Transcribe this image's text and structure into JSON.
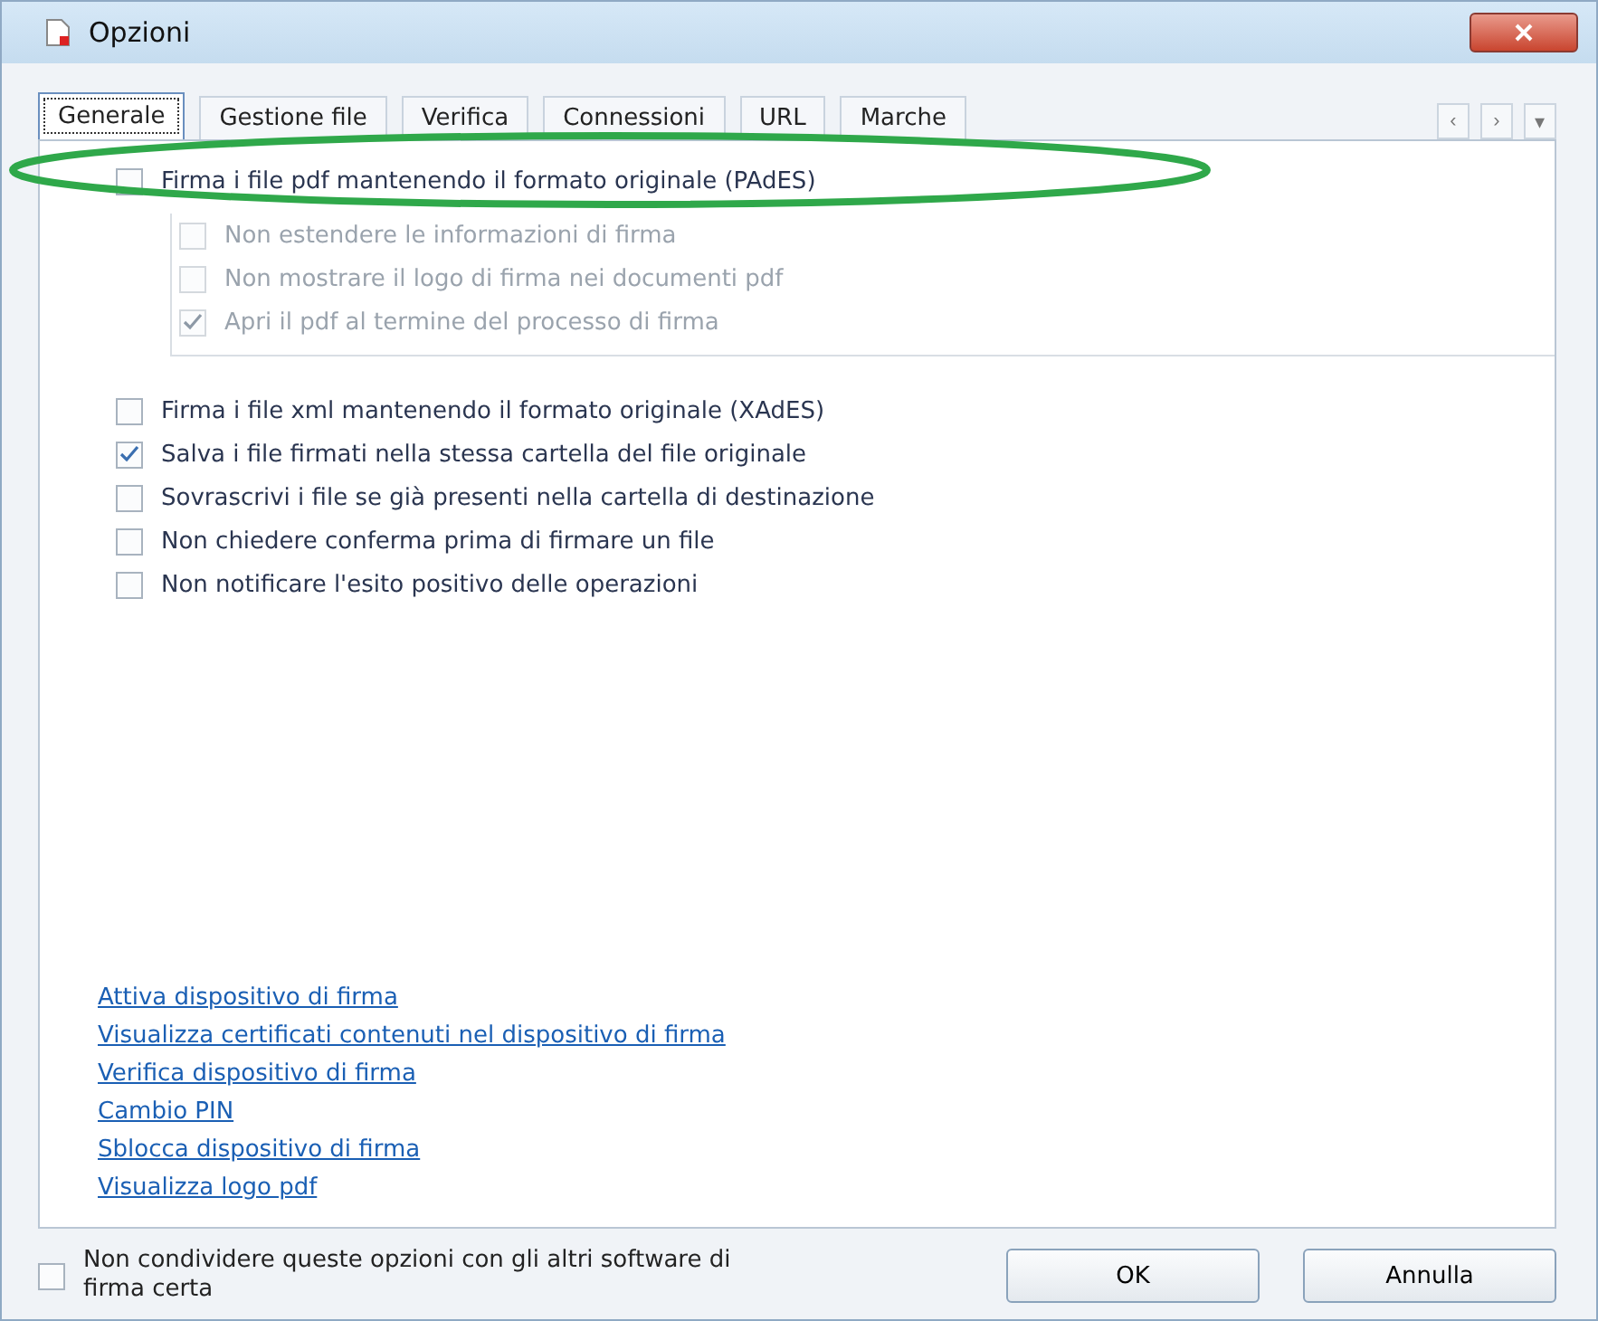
{
  "window": {
    "title": "Opzioni"
  },
  "tabs": [
    {
      "label": "Generale",
      "selected": true
    },
    {
      "label": "Gestione file",
      "selected": false
    },
    {
      "label": "Verifica",
      "selected": false
    },
    {
      "label": "Connessioni",
      "selected": false
    },
    {
      "label": "URL",
      "selected": false
    },
    {
      "label": "Marche",
      "selected": false
    }
  ],
  "tab_scroll": [
    "‹",
    "›",
    "▾"
  ],
  "pades": {
    "label": "Firma i file pdf mantenendo il formato originale (PAdES)",
    "checked": false,
    "highlighted": true,
    "children": [
      {
        "label": "Non estendere le informazioni di firma",
        "checked": false,
        "disabled": true
      },
      {
        "label": "Non mostrare il logo di firma nei documenti pdf",
        "checked": false,
        "disabled": true
      },
      {
        "label": "Apri il pdf al termine del processo di firma",
        "checked": true,
        "disabled": true
      }
    ]
  },
  "options": [
    {
      "label": "Firma i file xml mantenendo il formato originale (XAdES)",
      "checked": false
    },
    {
      "label": "Salva i file firmati nella stessa cartella del file originale",
      "checked": true
    },
    {
      "label": "Sovrascrivi i file se già presenti nella cartella di destinazione",
      "checked": false
    },
    {
      "label": "Non chiedere conferma prima di firmare un file",
      "checked": false
    },
    {
      "label": "Non notificare l'esito positivo delle operazioni",
      "checked": false
    }
  ],
  "links": [
    "Attiva dispositivo di firma",
    "Visualizza certificati contenuti nel dispositivo di firma",
    "Verifica dispositivo di firma",
    "Cambio PIN",
    "Sblocca dispositivo di firma",
    "Visualizza logo pdf"
  ],
  "footer": {
    "checkbox": {
      "label": "Non condividere queste opzioni con gli altri software di firma certa",
      "checked": false
    },
    "buttons": [
      "OK",
      "Annulla"
    ]
  }
}
